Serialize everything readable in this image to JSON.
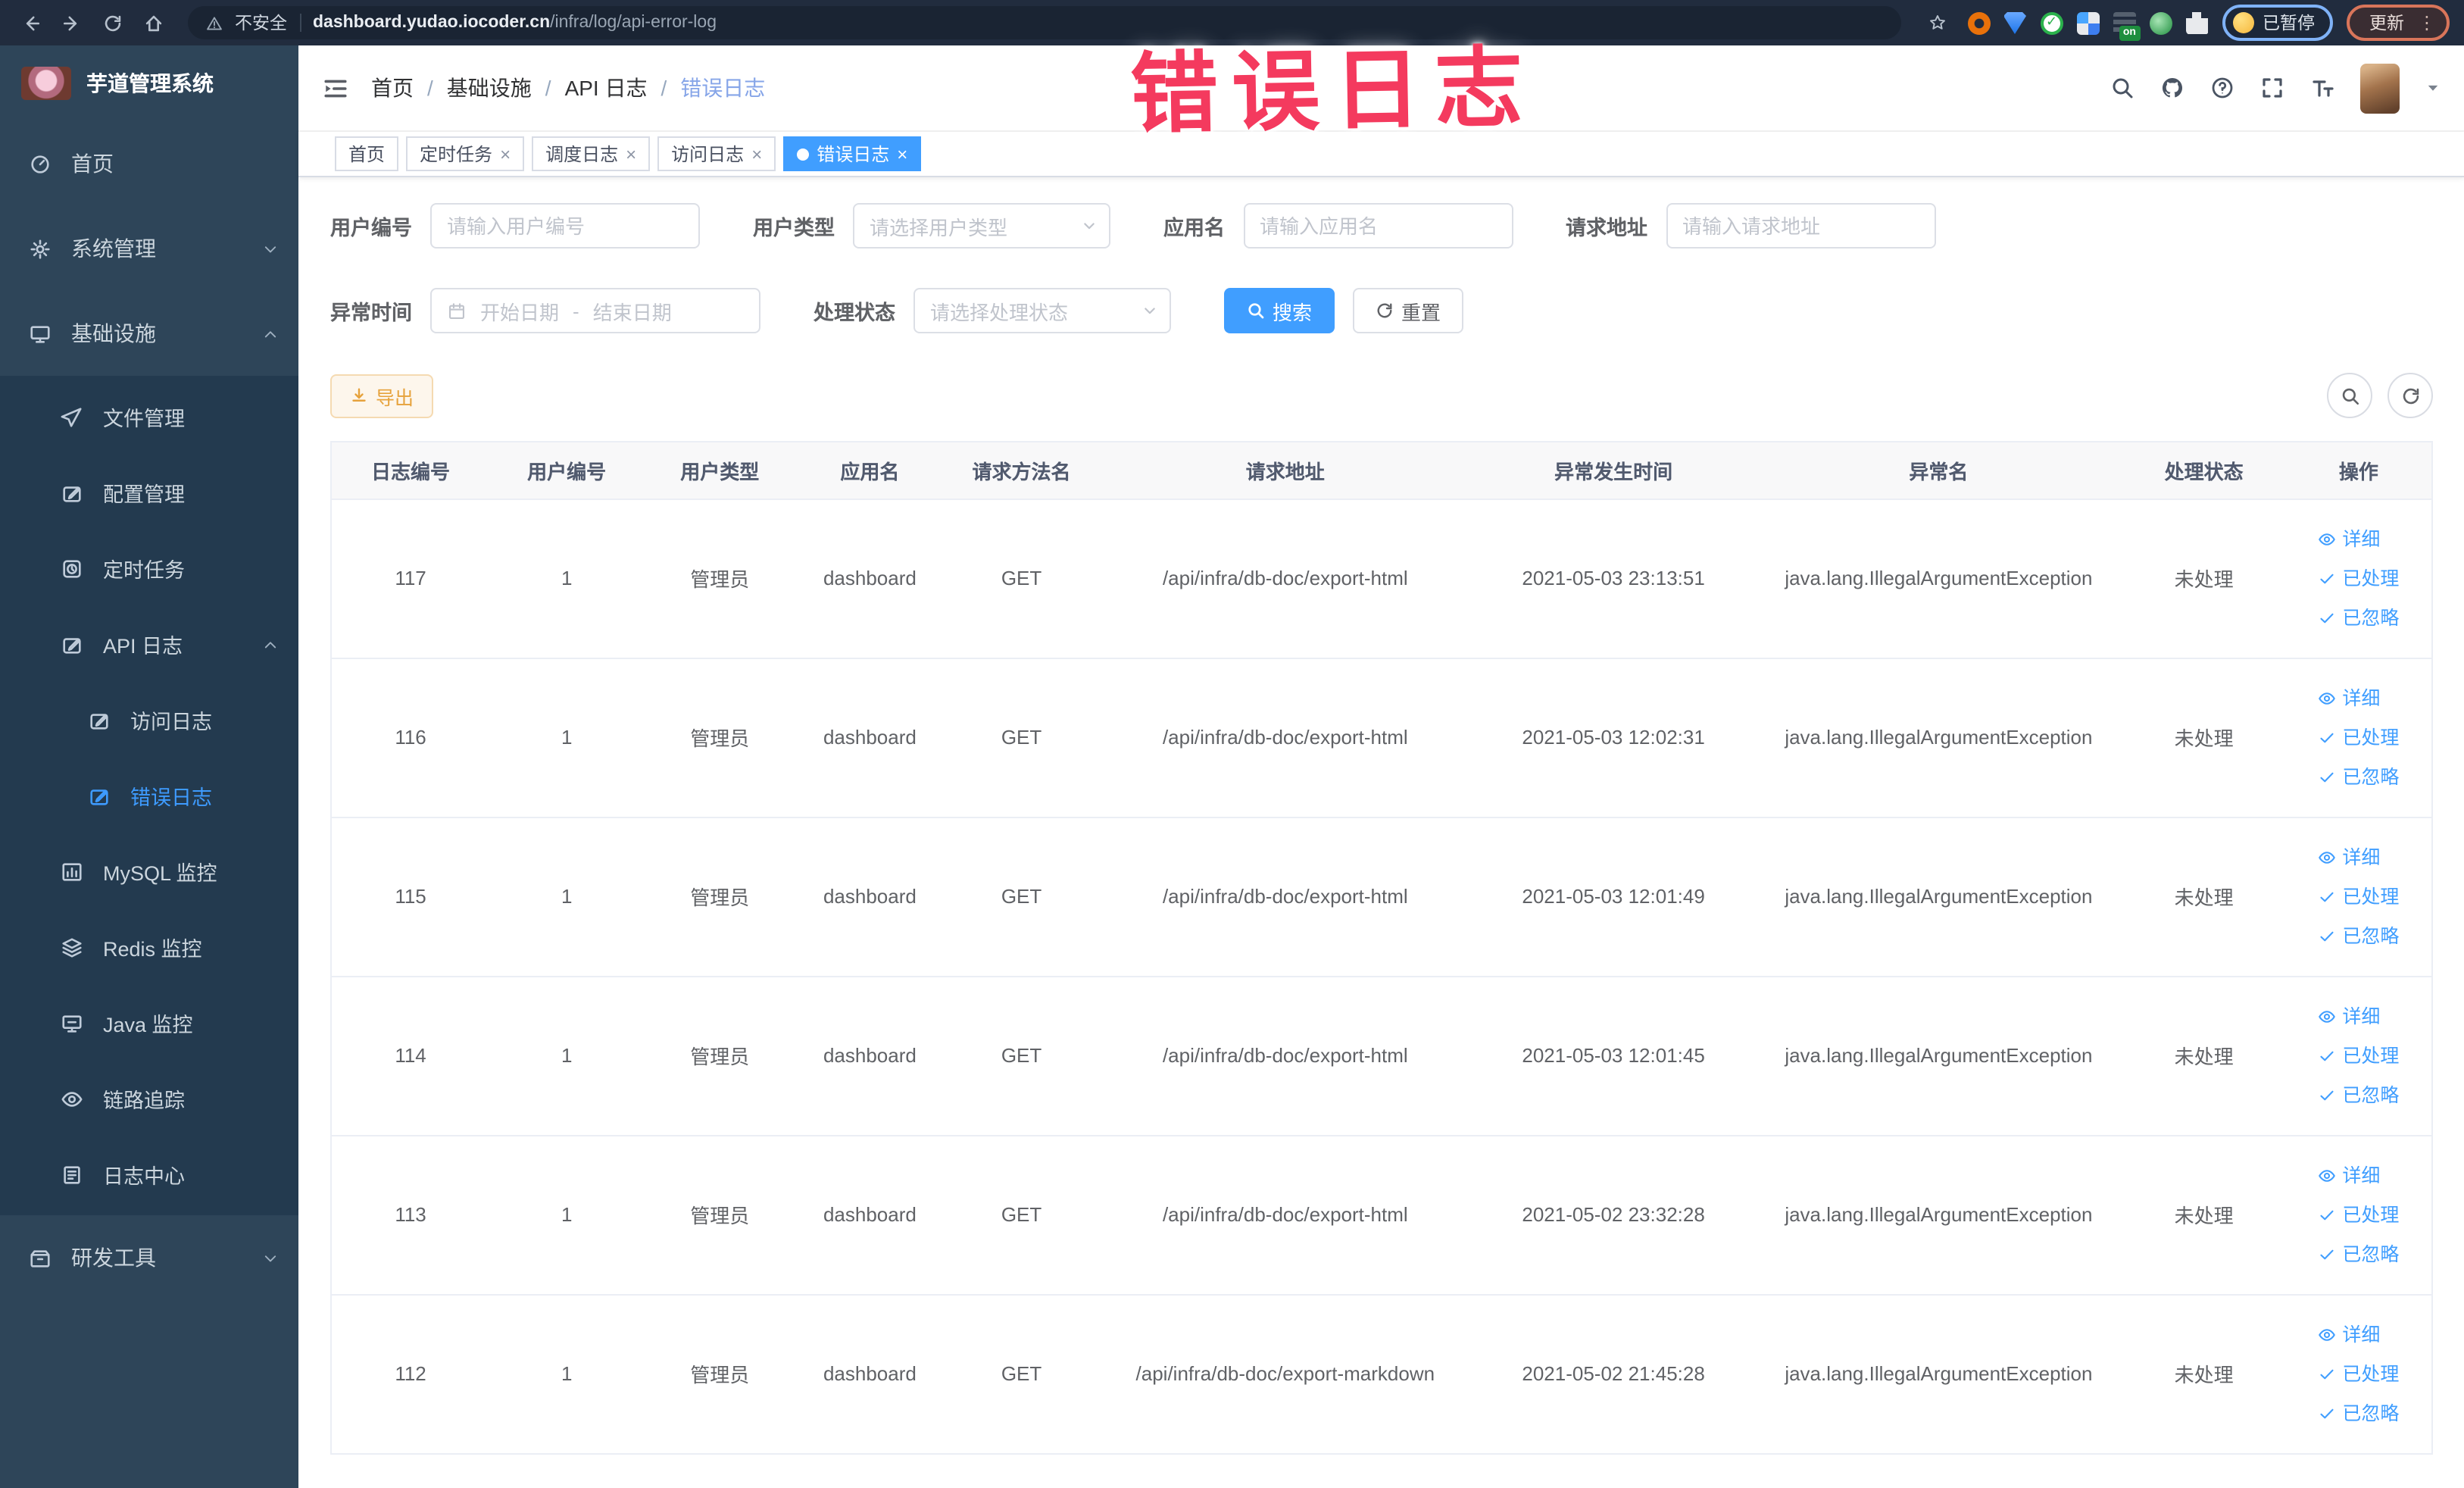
{
  "watermark": "错误日志",
  "browser": {
    "nav_icons": [
      "back-icon",
      "forward-icon",
      "reload-icon",
      "home-icon"
    ],
    "security_label": "不安全",
    "url_domain": "dashboard.yudao.iocoder.cn",
    "url_path": "/infra/log/api-error-log",
    "bookmark_icon": "star-icon",
    "extension_icons": [
      "orange-ring-extension-icon",
      "blue-shield-extension-icon",
      "green-check-extension-icon",
      "grid-extension-icon",
      "onbar-extension-icon",
      "green-sprout-extension-icon",
      "puzzle-extension-icon"
    ],
    "extension_on_badge": "on",
    "paused_badge": "已暂停",
    "update_button": "更新"
  },
  "sidebar": {
    "logo_title": "芋道管理系统",
    "items": [
      {
        "label": "首页",
        "icon": "dashboard-icon",
        "level": 1,
        "chevron": "",
        "active": false,
        "block": "top"
      },
      {
        "label": "系统管理",
        "icon": "gear-icon",
        "level": 1,
        "chevron": "down",
        "active": false,
        "block": "top"
      },
      {
        "label": "基础设施",
        "icon": "monitor-icon",
        "level": 1,
        "chevron": "up",
        "active": false,
        "block": "top"
      },
      {
        "label": "文件管理",
        "icon": "send-icon",
        "level": 2,
        "chevron": "",
        "active": false,
        "block": "sub"
      },
      {
        "label": "配置管理",
        "icon": "edit-icon",
        "level": 2,
        "chevron": "",
        "active": false,
        "block": "sub"
      },
      {
        "label": "定时任务",
        "icon": "timer-icon",
        "level": 2,
        "chevron": "",
        "active": false,
        "block": "sub"
      },
      {
        "label": "API 日志",
        "icon": "log-edit-icon",
        "level": 2,
        "chevron": "up",
        "active": false,
        "block": "sub"
      },
      {
        "label": "访问日志",
        "icon": "edit-icon",
        "level": 3,
        "chevron": "",
        "active": false,
        "block": "sub"
      },
      {
        "label": "错误日志",
        "icon": "edit-icon",
        "level": 3,
        "chevron": "",
        "active": true,
        "block": "sub"
      },
      {
        "label": "MySQL 监控",
        "icon": "chart-icon",
        "level": 2,
        "chevron": "",
        "active": false,
        "block": "sub"
      },
      {
        "label": "Redis 监控",
        "icon": "layers-icon",
        "level": 2,
        "chevron": "",
        "active": false,
        "block": "sub"
      },
      {
        "label": "Java 监控",
        "icon": "java-monitor-icon",
        "level": 2,
        "chevron": "",
        "active": false,
        "block": "sub"
      },
      {
        "label": "链路追踪",
        "icon": "eye-icon",
        "level": 2,
        "chevron": "",
        "active": false,
        "block": "sub"
      },
      {
        "label": "日志中心",
        "icon": "doc-edit-icon",
        "level": 2,
        "chevron": "",
        "active": false,
        "block": "sub"
      },
      {
        "label": "研发工具",
        "icon": "toolbox-icon",
        "level": 1,
        "chevron": "down",
        "active": false,
        "block": "bottom"
      }
    ]
  },
  "header": {
    "hamburger_icon": "hamburger-icon",
    "breadcrumb": [
      "首页",
      "基础设施",
      "API 日志",
      "错误日志"
    ],
    "right_icons": [
      "search-icon",
      "github-icon",
      "help-icon",
      "fullscreen-icon",
      "font-size-icon"
    ]
  },
  "tabs": [
    {
      "label": "首页",
      "closable": false,
      "active": false
    },
    {
      "label": "定时任务",
      "closable": true,
      "active": false
    },
    {
      "label": "调度日志",
      "closable": true,
      "active": false
    },
    {
      "label": "访问日志",
      "closable": true,
      "active": false
    },
    {
      "label": "错误日志",
      "closable": true,
      "active": true
    }
  ],
  "filters": {
    "user_id": {
      "label": "用户编号",
      "placeholder": "请输入用户编号"
    },
    "user_type": {
      "label": "用户类型",
      "placeholder": "请选择用户类型"
    },
    "app_name": {
      "label": "应用名",
      "placeholder": "请输入应用名"
    },
    "request_url": {
      "label": "请求地址",
      "placeholder": "请输入请求地址"
    },
    "exception_time": {
      "label": "异常时间",
      "start_placeholder": "开始日期",
      "separator": "-",
      "end_placeholder": "结束日期"
    },
    "process_status": {
      "label": "处理状态",
      "placeholder": "请选择处理状态"
    },
    "search_button": "搜索",
    "reset_button": "重置"
  },
  "toolbar": {
    "export_button": "导出",
    "right_buttons": [
      "search-toggle-icon",
      "refresh-icon"
    ]
  },
  "table": {
    "columns": [
      "日志编号",
      "用户编号",
      "用户类型",
      "应用名",
      "请求方法名",
      "请求地址",
      "异常发生时间",
      "异常名",
      "处理状态",
      "操作"
    ],
    "actions": [
      {
        "icon": "eye-icon",
        "label": "详细"
      },
      {
        "icon": "check-icon",
        "label": "已处理"
      },
      {
        "icon": "check-icon",
        "label": "已忽略"
      }
    ],
    "rows": [
      {
        "log_id": "117",
        "user_id": "1",
        "user_type": "管理员",
        "app_name": "dashboard",
        "method": "GET",
        "url": "/api/infra/db-doc/export-html",
        "time": "2021-05-03 23:13:51",
        "exception": "java.lang.IllegalArgumentException",
        "status": "未处理"
      },
      {
        "log_id": "116",
        "user_id": "1",
        "user_type": "管理员",
        "app_name": "dashboard",
        "method": "GET",
        "url": "/api/infra/db-doc/export-html",
        "time": "2021-05-03 12:02:31",
        "exception": "java.lang.IllegalArgumentException",
        "status": "未处理"
      },
      {
        "log_id": "115",
        "user_id": "1",
        "user_type": "管理员",
        "app_name": "dashboard",
        "method": "GET",
        "url": "/api/infra/db-doc/export-html",
        "time": "2021-05-03 12:01:49",
        "exception": "java.lang.IllegalArgumentException",
        "status": "未处理"
      },
      {
        "log_id": "114",
        "user_id": "1",
        "user_type": "管理员",
        "app_name": "dashboard",
        "method": "GET",
        "url": "/api/infra/db-doc/export-html",
        "time": "2021-05-03 12:01:45",
        "exception": "java.lang.IllegalArgumentException",
        "status": "未处理"
      },
      {
        "log_id": "113",
        "user_id": "1",
        "user_type": "管理员",
        "app_name": "dashboard",
        "method": "GET",
        "url": "/api/infra/db-doc/export-html",
        "time": "2021-05-02 23:32:28",
        "exception": "java.lang.IllegalArgumentException",
        "status": "未处理"
      },
      {
        "log_id": "112",
        "user_id": "1",
        "user_type": "管理员",
        "app_name": "dashboard",
        "method": "GET",
        "url": "/api/infra/db-doc/export-markdown",
        "time": "2021-05-02 21:45:28",
        "exception": "java.lang.IllegalArgumentException",
        "status": "未处理"
      }
    ]
  },
  "colors": {
    "primary": "#409eff",
    "watermark": "#f43a5e",
    "sidebar_bg": "#2e4559",
    "submenu_bg": "#233a4f",
    "export_warning": "#e6a23c",
    "chrome_bg": "#212c3e"
  }
}
